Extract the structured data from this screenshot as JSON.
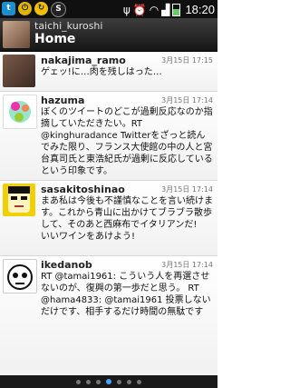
{
  "statusbar": {
    "time": "18:20",
    "left_icons": [
      "twitter-icon",
      "power-icon",
      "sync-icon",
      "s-app-icon"
    ],
    "right_icons": [
      "usb-icon",
      "alarm-icon",
      "wifi-icon",
      "signal-icon",
      "battery-icon"
    ]
  },
  "header": {
    "username": "taichi_kuroshi",
    "title": "Home"
  },
  "tweets": [
    {
      "name": "nakajima_ramo",
      "date": "3月15日 17:15",
      "text": "ゲェッ!に…肉を残しはった…"
    },
    {
      "name": "hazuma",
      "date": "3月15日 17:14",
      "text": "ぼくのツイートのどこが過剰反応なのか指摘していただきたい。RT @kinghuradance Twitterをざっと読んでみた限り、フランス大使館の中の人と宮台真司氏と東浩紀氏が過剰に反応しているという印象です。"
    },
    {
      "name": "sasakitoshinao",
      "date": "3月15日 17:14",
      "text": "まあ私は今後も不謹慎なことを言い続けます。これから青山に出かけてブラブラ散歩して、そのあと西麻布でイタリアンだ!　いいワインをあけよう!"
    },
    {
      "name": "ikedanob",
      "date": "3月15日 17:14",
      "text": "RT @tamai1961: こういう人を再選させないのが、復興の第一歩だと思う。 RT @hama4833: @tamai1961 投票しないだけです、相手するだけ時間の無駄です"
    }
  ],
  "pager": {
    "count": 7,
    "active": 3
  }
}
